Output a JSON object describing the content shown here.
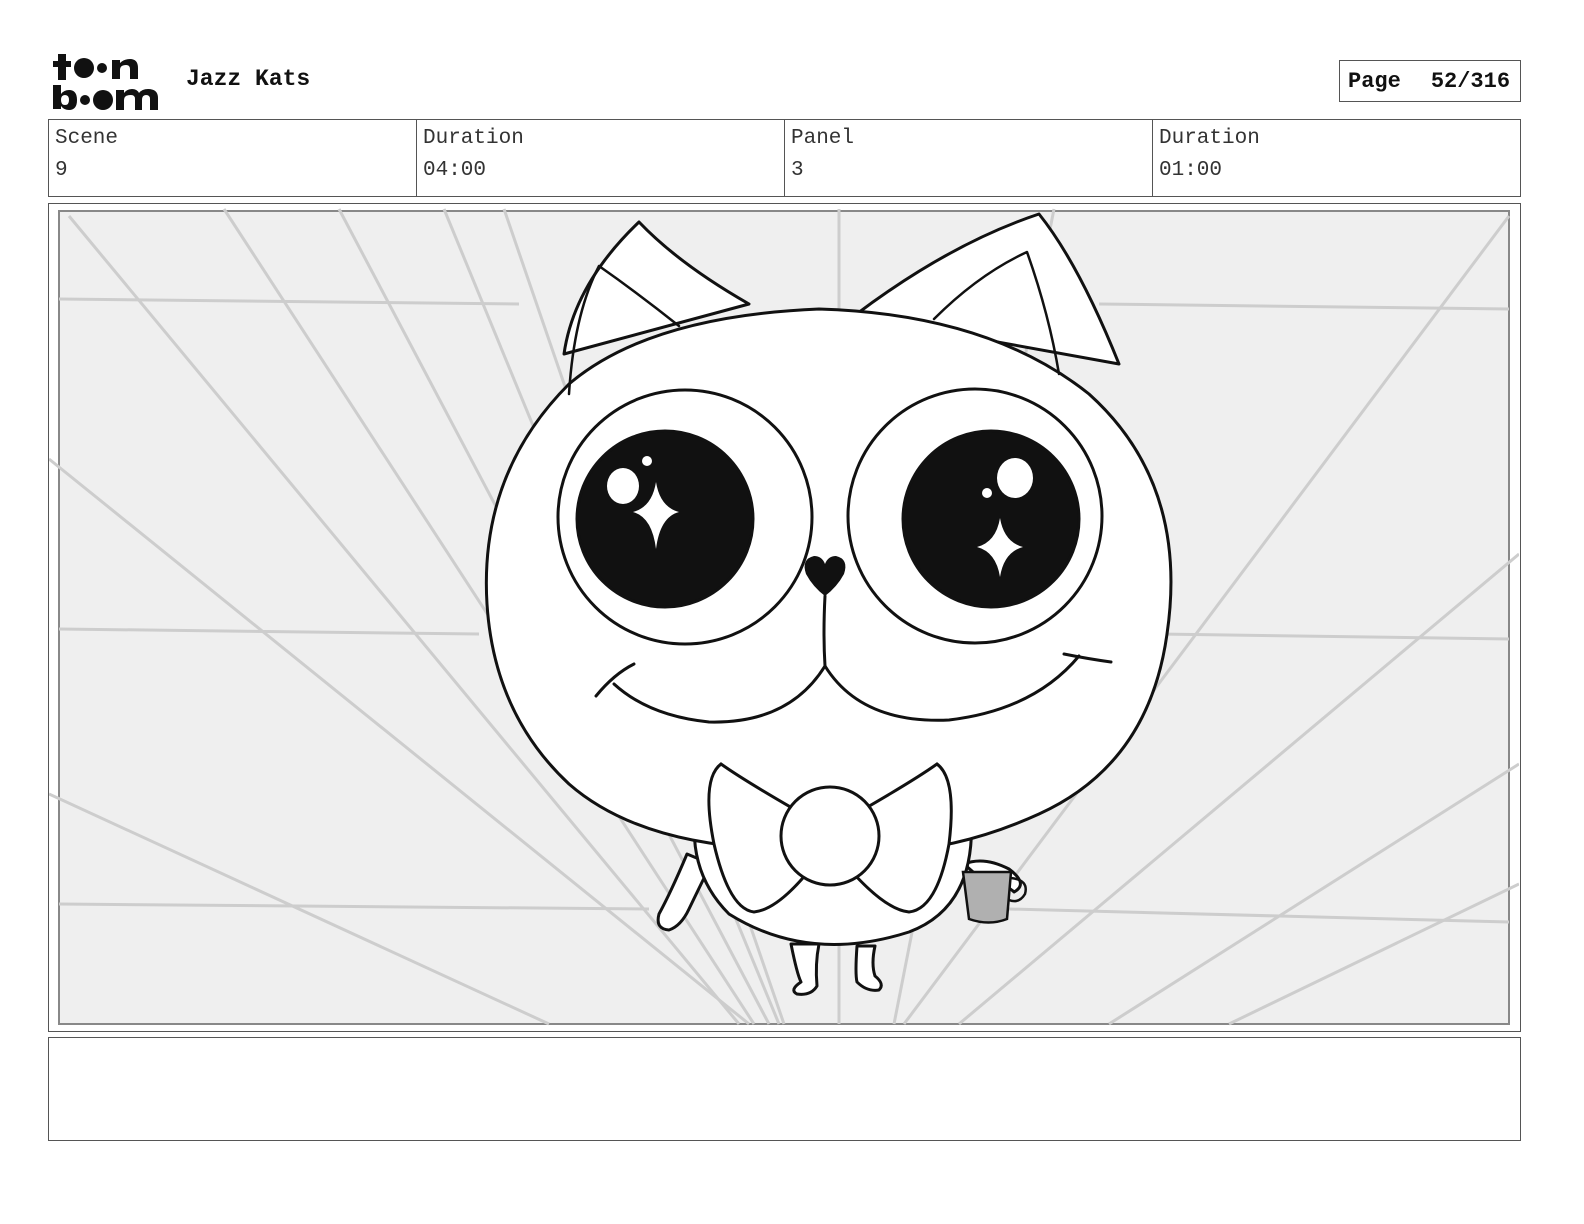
{
  "header": {
    "logo_text": "toon boom",
    "project_title": "Jazz Kats",
    "page_label": "Page",
    "page_number": "52/316"
  },
  "info": {
    "scene_label": "Scene",
    "scene_value": "9",
    "scene_duration_label": "Duration",
    "scene_duration_value": "04:00",
    "panel_label": "Panel",
    "panel_value": "3",
    "panel_duration_label": "Duration",
    "panel_duration_value": "01:00"
  },
  "notes": {
    "text": ""
  }
}
